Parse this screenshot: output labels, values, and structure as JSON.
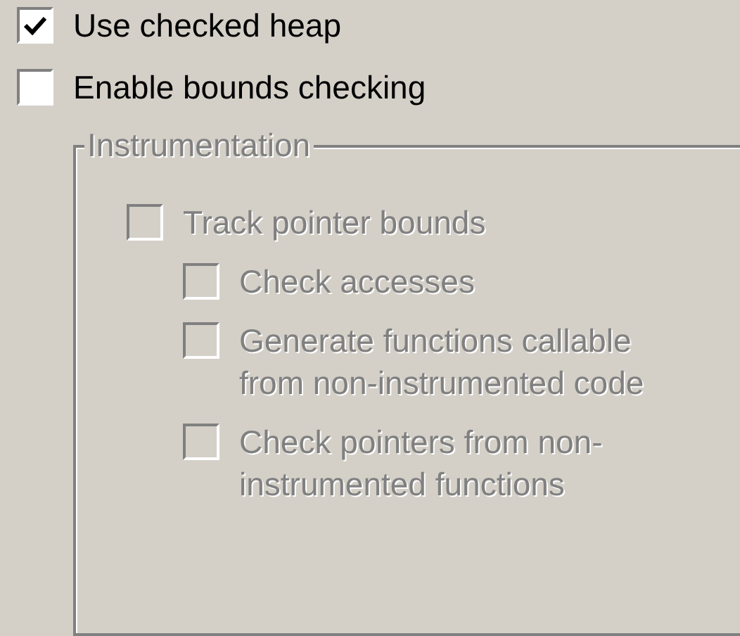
{
  "options": [
    {
      "label": "Use checked heap",
      "checked": true,
      "disabled": false
    },
    {
      "label": "Enable bounds checking",
      "checked": false,
      "disabled": false
    }
  ],
  "group": {
    "title": "Instrumentation",
    "disabled": true,
    "items": [
      {
        "label": "Track pointer bounds",
        "checked": false,
        "disabled": true,
        "children": [
          {
            "label": "Check accesses",
            "checked": false,
            "disabled": true
          },
          {
            "label": "Generate functions callable from non-instrumented code",
            "checked": false,
            "disabled": true
          },
          {
            "label": "Check pointers from non-instrumented functions",
            "checked": false,
            "disabled": true
          }
        ]
      }
    ]
  }
}
